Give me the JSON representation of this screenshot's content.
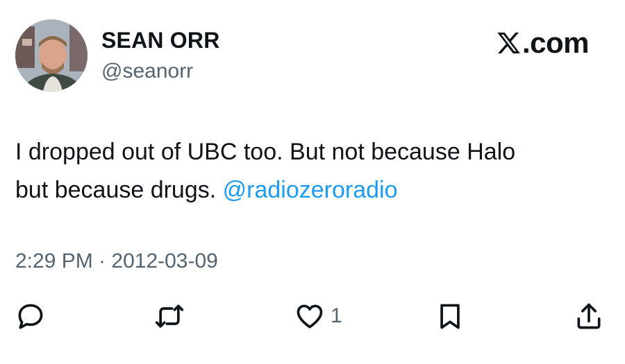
{
  "author": {
    "display_name": "SEAN ORR",
    "handle": "@seanorr",
    "avatar_icon": "profile-photo"
  },
  "brand": {
    "label": ".com",
    "icon": "x-logo-icon"
  },
  "tweet": {
    "text_line1": "I dropped out of UBC too. But not because Halo",
    "text_line2": "but because drugs. ",
    "mention": "@radiozeroradio",
    "timestamp": "2:29 PM · 2012-03-09"
  },
  "actions": {
    "reply_icon": "speech-bubble-icon",
    "retweet_icon": "retweet-arrows-icon",
    "like_icon": "heart-icon",
    "like_count": "1",
    "bookmark_icon": "bookmark-icon",
    "share_icon": "share-icon"
  },
  "colors": {
    "text": "#0f1419",
    "secondary": "#536471",
    "link": "#1d9bf0",
    "background": "#ffffff"
  }
}
